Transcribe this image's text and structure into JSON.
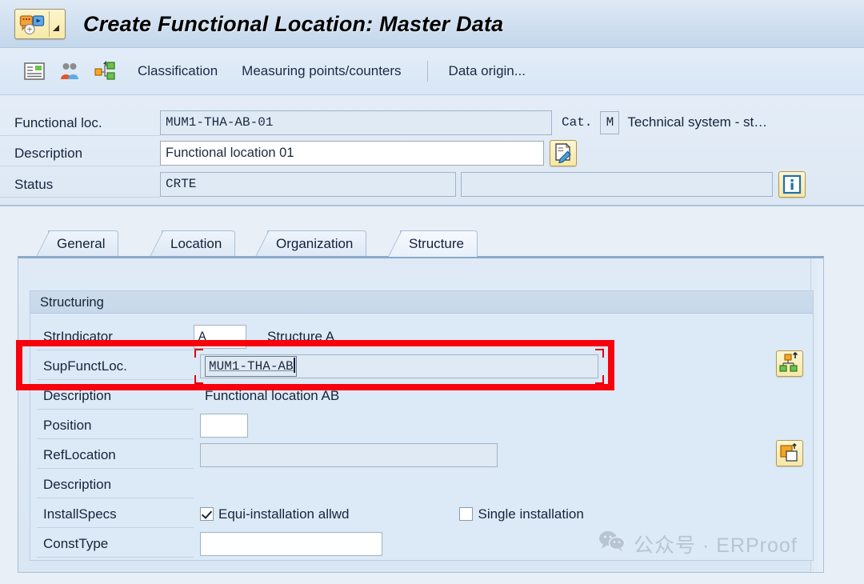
{
  "window": {
    "title": "Create Functional Location: Master Data",
    "menu_button_icon": "sap-menu-icon",
    "menu_button_arrow_icon": "chevron-down-icon"
  },
  "toolbar": {
    "icons": [
      {
        "name": "details-list-icon"
      },
      {
        "name": "partners-people-icon"
      },
      {
        "name": "structure-hierarchy-icon"
      }
    ],
    "items": [
      {
        "label": "Classification"
      },
      {
        "label": "Measuring points/counters"
      },
      {
        "label": "Data origin..."
      }
    ]
  },
  "header": {
    "functional_loc": {
      "label": "Functional loc.",
      "value": "MUM1-THA-AB-01",
      "readonly": true
    },
    "category": {
      "label": "Cat.",
      "value": "M",
      "text": "Technical system - st…"
    },
    "description": {
      "label": "Description",
      "value": "Functional location 01",
      "placeholder": ""
    },
    "description_edit_icon": "long-text-edit-icon",
    "status": {
      "label": "Status",
      "value": "CRTE",
      "value2": ""
    },
    "status_info_icon": "info-icon"
  },
  "tabs": [
    {
      "label": "General",
      "active": false
    },
    {
      "label": "Location",
      "active": false
    },
    {
      "label": "Organization",
      "active": false
    },
    {
      "label": "Structure",
      "active": true
    }
  ],
  "structuring": {
    "group_title": "Structuring",
    "str_indicator": {
      "label": "StrIndicator",
      "value": "A",
      "text": "Structure A"
    },
    "sup_funct_loc": {
      "label": "SupFunctLoc.",
      "value": "MUM1-THA-AB",
      "focused": true
    },
    "sup_description": {
      "label": "Description",
      "value": "Functional location AB"
    },
    "position": {
      "label": "Position",
      "value": ""
    },
    "ref_location": {
      "label": "RefLocation",
      "value": ""
    },
    "ref_description": {
      "label": "Description",
      "value": ""
    },
    "install_specs": {
      "label": "InstallSpecs",
      "equi_install_label": "Equi-installation allwd",
      "equi_install_checked": true,
      "single_install_label": "Single installation",
      "single_install_checked": false
    },
    "const_type": {
      "label": "ConstType",
      "value": ""
    },
    "hierarchy_icon": "structure-hierarchy-button-icon",
    "copy_icon": "copy-reference-icon"
  },
  "annotation": {
    "highlight_color": "#f8000c",
    "target": "sup-funct-loc-row"
  },
  "watermark": {
    "icon": "wechat-icon",
    "text": "公众号 · ERProof",
    "color": "#b6c3d2"
  }
}
